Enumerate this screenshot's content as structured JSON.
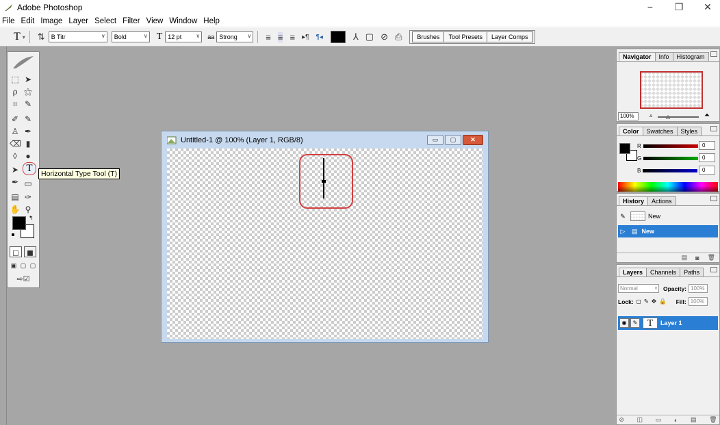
{
  "window": {
    "title": "Adobe Photoshop",
    "controls": [
      "−",
      "❐",
      "✕"
    ]
  },
  "menu": [
    "File",
    "Edit",
    "Image",
    "Layer",
    "Select",
    "Filter",
    "View",
    "Window",
    "Help"
  ],
  "options_bar": {
    "font_family": "B Titr",
    "font_style": "Bold",
    "font_size": "12 pt",
    "anti_alias_prefix": "aa",
    "anti_alias": "Strong",
    "text_color": "#000000",
    "palette_tabs": [
      "Brushes",
      "Tool Presets",
      "Layer Comps"
    ]
  },
  "toolbox": {
    "active_tool": "Horizontal Type Tool",
    "tooltip": "Horizontal Type Tool (T)",
    "type_tool_glyph": "T"
  },
  "document": {
    "title": "Untitled-1 @ 100% (Layer 1, RGB/8)"
  },
  "navigator_panel": {
    "tabs": [
      "Navigator",
      "Info",
      "Histogram"
    ],
    "zoom": "100%"
  },
  "color_panel": {
    "tabs": [
      "Color",
      "Swatches",
      "Styles"
    ],
    "channels": [
      {
        "label": "R",
        "value": "0",
        "color": "#cc0000"
      },
      {
        "label": "G",
        "value": "0",
        "color": "#00aa00"
      },
      {
        "label": "B",
        "value": "0",
        "color": "#0000cc"
      }
    ]
  },
  "history_panel": {
    "tabs": [
      "History",
      "Actions"
    ],
    "snapshot_label": "New",
    "states": [
      "New"
    ]
  },
  "layers_panel": {
    "tabs": [
      "Layers",
      "Channels",
      "Paths"
    ],
    "blend_mode": "Normal",
    "opacity_label": "Opacity:",
    "opacity": "100%",
    "lock_label": "Lock:",
    "fill_label": "Fill:",
    "fill": "100%",
    "layer_name": "Layer 1",
    "layer_glyph": "T"
  }
}
